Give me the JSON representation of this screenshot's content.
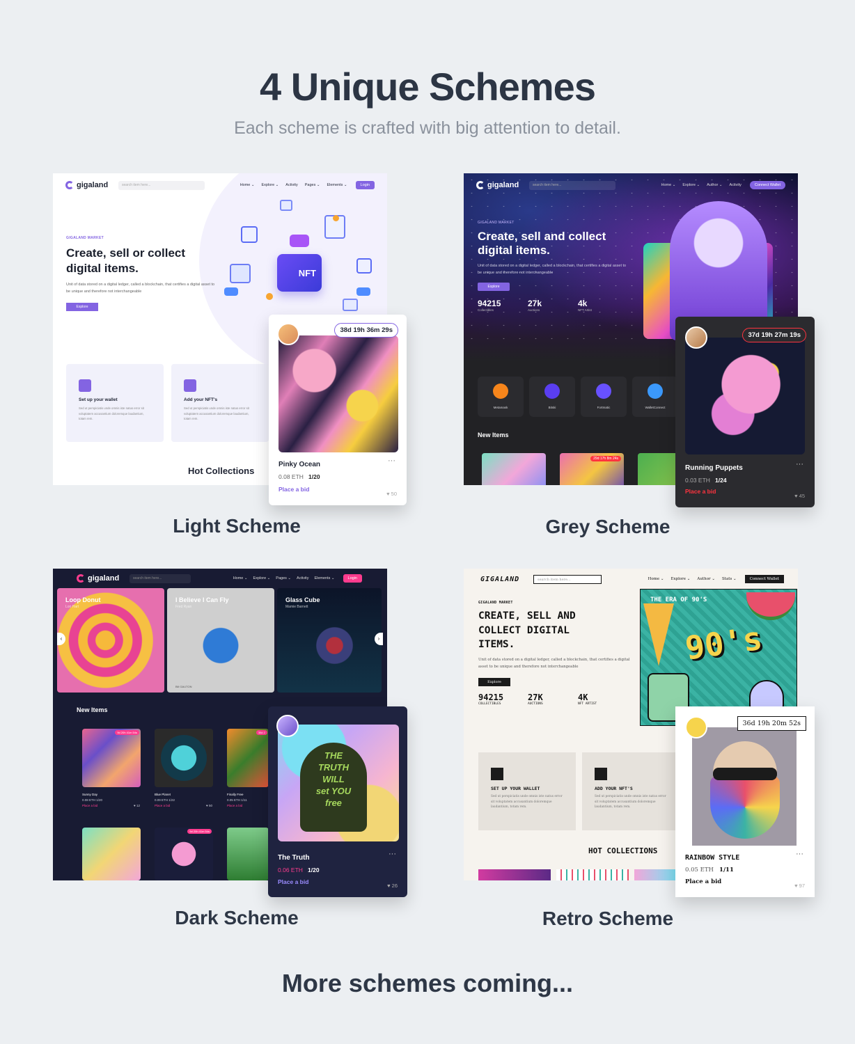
{
  "header": {
    "title": "4 Unique Schemes",
    "subtitle": "Each scheme is crafted with big attention to detail."
  },
  "common": {
    "brand": "gigaland",
    "search_placeholder": "search item here...",
    "hero_kicker": "GIGALAND MARKET",
    "hero_title_line1": "Create, sell and collect",
    "hero_title_line2": "digital items.",
    "hero_text": "Unit of data stored on a digital ledger, called a blockchain, that certifies a digital asset to be unique and therefore not interchangeable",
    "explore": "Explore",
    "stats": [
      {
        "num": "94215",
        "label": "Collectibles"
      },
      {
        "num": "27k",
        "label": "Auctions"
      },
      {
        "num": "4k",
        "label": "NFT Artist"
      }
    ],
    "feature_desc": "Sed ut perspiciatis unde omnis iste natus error sit voluptatem accusantium doloremque laudantium, totam rem.",
    "new_items": "New Items",
    "hot_collections": "Hot Collections",
    "place_bid": "Place a bid"
  },
  "light": {
    "caption": "Light Scheme",
    "menu": [
      "Home ⌄",
      "Explore ⌄",
      "Activity",
      "Pages ⌄",
      "Elements ⌄"
    ],
    "nav_button": "Login",
    "hero_title_line1": "Create, sell or collect",
    "nft_label": "NFT",
    "features": [
      {
        "title": "Set up your wallet"
      },
      {
        "title": "Add your NFT's"
      }
    ],
    "card": {
      "timer": "38d  19h  36m  29s",
      "title": "Pinky Ocean",
      "price": "0.08 ETH",
      "qty": "1/20",
      "likes": "50"
    }
  },
  "grey": {
    "caption": "Grey Scheme",
    "menu": [
      "Home ⌄",
      "Explore ⌄",
      "Author ⌄",
      "Activity"
    ],
    "nav_button": "Connect Wallet",
    "wallets": [
      "Metamask",
      "Bitski",
      "Fortmatic",
      "WalletConnect"
    ],
    "card": {
      "timer": "37d  19h  27m  19s",
      "title": "Running Puppets",
      "price": "0.03 ETH",
      "qty": "1/24",
      "likes": "45"
    },
    "mini_timer": "29d  17h  8m  24s"
  },
  "dark": {
    "caption": "Dark Scheme",
    "menu": [
      "Home ⌄",
      "Explore ⌄",
      "Pages ⌄",
      "Activity",
      "Elements ⌄"
    ],
    "nav_button": "Login",
    "slides": [
      {
        "title": "Loop Donut",
        "sub": "Lori Hart"
      },
      {
        "title": "I Believe I Can Fly",
        "sub": "Fred Ryan"
      },
      {
        "title": "Glass Cube",
        "sub": "Mamie Barnett"
      }
    ],
    "slide_credit": "Bill GAUTON",
    "items": [
      {
        "title": "Sunny Day",
        "price": "0.08 ETH",
        "qty": "1/20",
        "likes": "12",
        "timer": "9d 20h 41m 54s"
      },
      {
        "title": "Blue Planet",
        "price": "0.09 ETH",
        "qty": "1/22",
        "likes": "50",
        "timer": ""
      },
      {
        "title": "Finally Free",
        "price": "0.05 ETH",
        "qty": "1/11",
        "likes": "",
        "timer": "38d 2"
      }
    ],
    "row2_timer": "9d 20h 41m 54s",
    "card": {
      "title": "The Truth",
      "price": "0.06 ETH",
      "qty": "1/20",
      "likes": "26",
      "art_text": [
        "THE",
        "TRUTH",
        "WILL",
        "set",
        "YOU",
        "free"
      ]
    }
  },
  "retro": {
    "caption": "Retro Scheme",
    "brand": "GIGALAND",
    "menu": [
      "Home ⌄",
      "Explore ⌄",
      "Author ⌄",
      "Stats ⌄"
    ],
    "nav_button": "Connect Wallet",
    "hero_title": [
      "CREATE, SELL AND",
      "COLLECT DIGITAL",
      "ITEMS."
    ],
    "stats": [
      {
        "num": "94215",
        "label": "COLLECTIBLES"
      },
      {
        "num": "27K",
        "label": "AUCTIONS"
      },
      {
        "num": "4K",
        "label": "NFT ARTIST"
      }
    ],
    "poster_title": "THE ERA OF 90'S",
    "poster_big": "90's",
    "features": [
      {
        "title": "SET UP YOUR WALLET"
      },
      {
        "title": "ADD YOUR NFT'S"
      }
    ],
    "hot_collections": "HOT COLLECTIONS",
    "card": {
      "timer": "36d  19h  20m  52s",
      "title": "RAINBOW STYLE",
      "price": "0.05 ETH",
      "qty": "1/11",
      "likes": "97"
    }
  },
  "footer": "More schemes coming...",
  "colors": {
    "accent": "#8364e2",
    "grey_accent": "#ff343f",
    "retro_dark": "#1b1b1b"
  },
  "icons": [
    "heart-icon",
    "wallet-icon",
    "upload-icon",
    "metamask-icon",
    "bitski-icon",
    "fortmatic-icon",
    "walletconnect-icon",
    "chevron-left-icon",
    "chevron-right-icon"
  ]
}
